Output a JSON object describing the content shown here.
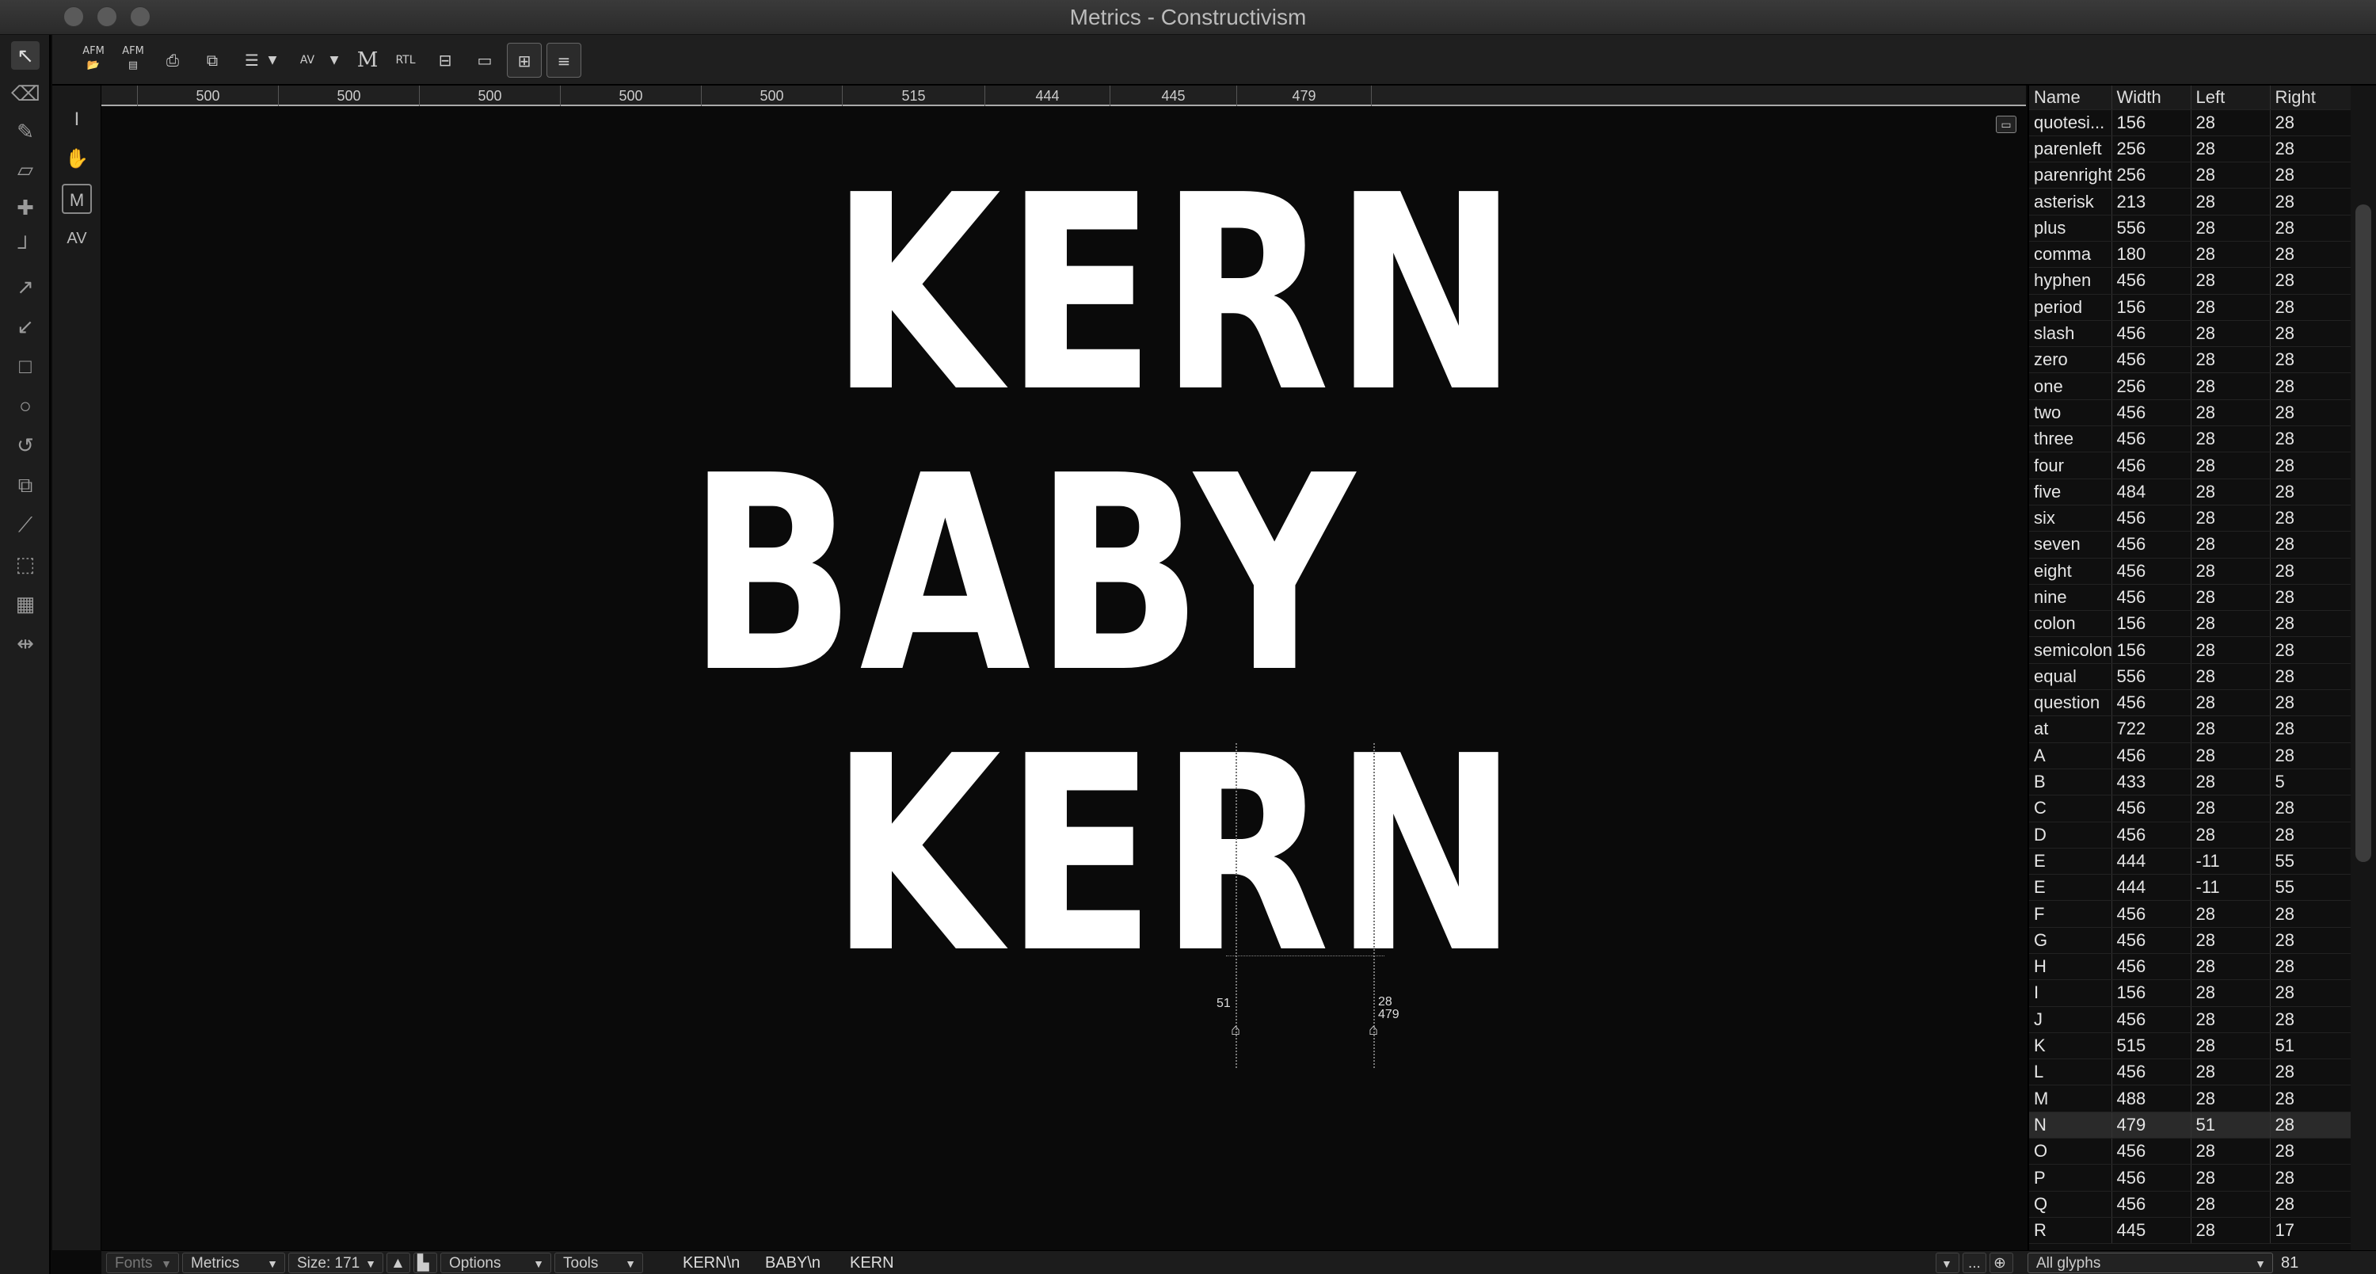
{
  "window": {
    "title": "Metrics - Constructivism"
  },
  "toolbar": {
    "afm_open_label": "AFM",
    "afm_save_label": "AFM",
    "metrics_label": "M",
    "rtl_label": "RTL",
    "kern_av_label": "AV"
  },
  "sidetools": {
    "text_tool": "I",
    "metrics_tool": "M",
    "kern_tool": "AV"
  },
  "ruler": {
    "values": [
      "500",
      "500",
      "500",
      "500",
      "500",
      "515",
      "444",
      "445",
      "479"
    ]
  },
  "canvas": {
    "lines": [
      "KERN",
      "BABY",
      "KERN"
    ],
    "metrics_readout": {
      "left_sidebearing": "51",
      "right_sidebearing": "28",
      "advance_width": "479"
    }
  },
  "glyph_table": {
    "columns": [
      "Name",
      "Width",
      "Left",
      "Right"
    ],
    "rows": [
      [
        "quotesi...",
        "156",
        "28",
        "28"
      ],
      [
        "parenleft",
        "256",
        "28",
        "28"
      ],
      [
        "parenright",
        "256",
        "28",
        "28"
      ],
      [
        "asterisk",
        "213",
        "28",
        "28"
      ],
      [
        "plus",
        "556",
        "28",
        "28"
      ],
      [
        "comma",
        "180",
        "28",
        "28"
      ],
      [
        "hyphen",
        "456",
        "28",
        "28"
      ],
      [
        "period",
        "156",
        "28",
        "28"
      ],
      [
        "slash",
        "456",
        "28",
        "28"
      ],
      [
        "zero",
        "456",
        "28",
        "28"
      ],
      [
        "one",
        "256",
        "28",
        "28"
      ],
      [
        "two",
        "456",
        "28",
        "28"
      ],
      [
        "three",
        "456",
        "28",
        "28"
      ],
      [
        "four",
        "456",
        "28",
        "28"
      ],
      [
        "five",
        "484",
        "28",
        "28"
      ],
      [
        "six",
        "456",
        "28",
        "28"
      ],
      [
        "seven",
        "456",
        "28",
        "28"
      ],
      [
        "eight",
        "456",
        "28",
        "28"
      ],
      [
        "nine",
        "456",
        "28",
        "28"
      ],
      [
        "colon",
        "156",
        "28",
        "28"
      ],
      [
        "semicolon",
        "156",
        "28",
        "28"
      ],
      [
        "equal",
        "556",
        "28",
        "28"
      ],
      [
        "question",
        "456",
        "28",
        "28"
      ],
      [
        "at",
        "722",
        "28",
        "28"
      ],
      [
        "A",
        "456",
        "28",
        "28"
      ],
      [
        "B",
        "433",
        "28",
        "5"
      ],
      [
        "C",
        "456",
        "28",
        "28"
      ],
      [
        "D",
        "456",
        "28",
        "28"
      ],
      [
        "E",
        "444",
        "-11",
        "55"
      ],
      [
        "E",
        "444",
        "-11",
        "55"
      ],
      [
        "F",
        "456",
        "28",
        "28"
      ],
      [
        "G",
        "456",
        "28",
        "28"
      ],
      [
        "H",
        "456",
        "28",
        "28"
      ],
      [
        "I",
        "156",
        "28",
        "28"
      ],
      [
        "J",
        "456",
        "28",
        "28"
      ],
      [
        "K",
        "515",
        "28",
        "51"
      ],
      [
        "L",
        "456",
        "28",
        "28"
      ],
      [
        "M",
        "488",
        "28",
        "28"
      ],
      [
        "N",
        "479",
        "51",
        "28"
      ],
      [
        "O",
        "456",
        "28",
        "28"
      ],
      [
        "P",
        "456",
        "28",
        "28"
      ],
      [
        "Q",
        "456",
        "28",
        "28"
      ],
      [
        "R",
        "445",
        "28",
        "17"
      ]
    ],
    "selected_row": 38
  },
  "statusbar": {
    "fonts_label": "Fonts",
    "mode_label": "Metrics",
    "size_label": "Size: 171",
    "options_label": "Options",
    "tools_label": "Tools",
    "text_segments": [
      "KERN\\n",
      "BABY\\n",
      "KERN"
    ],
    "ellipsis_label": "...",
    "glyph_filter": "All glyphs",
    "glyph_count": "81"
  }
}
